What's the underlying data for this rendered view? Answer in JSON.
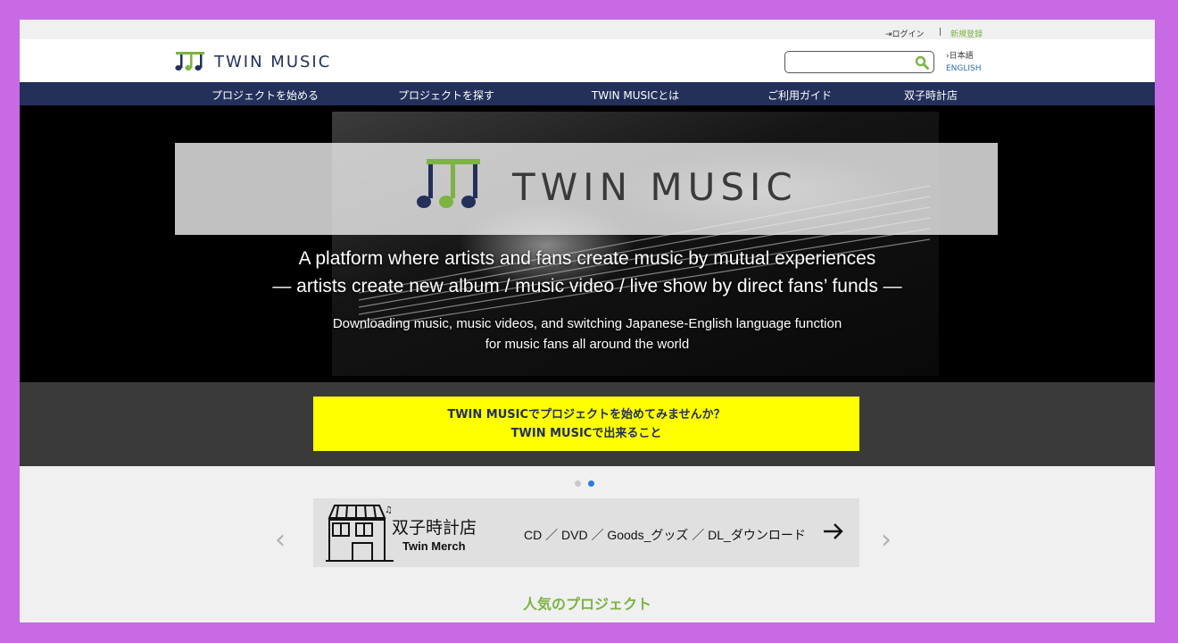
{
  "util": {
    "login": "ログイン",
    "separator": "|",
    "signup": "新規登録"
  },
  "header": {
    "brand": "TWIN MUSIC",
    "search_placeholder": "",
    "lang_ja": "›日本語",
    "lang_en": "ENGLISH"
  },
  "nav": {
    "items": [
      {
        "label": "プロジェクトを始める"
      },
      {
        "label": "プロジェクトを探す"
      },
      {
        "label": "TWIN MUSICとは"
      },
      {
        "label": "ご利用ガイド"
      },
      {
        "label": "双子時計店"
      }
    ]
  },
  "hero": {
    "brand": "TWIN MUSIC",
    "line1": "A platform where artists and fans create music by mutual experiences",
    "line2": "— artists create new album / music video / live show by direct fans’ funds —",
    "line3": "Downloading music, music videos, and switching Japanese-English language function",
    "line4": "for music fans all around the world"
  },
  "cta": {
    "line1": "TWIN MUSICでプロジェクトを始めてみませんか？",
    "line2": "TWIN MUSICで出来ること"
  },
  "carousel": {
    "slide_count": 2,
    "active_index": 1
  },
  "merch": {
    "shop_name": "双子時計店",
    "shop_sub": "Twin Merch",
    "categories": "CD ／ DVD ／ Goods_グッズ ／ DL_ダウンロード"
  },
  "sections": {
    "popular_title": "人気のプロジェクト"
  },
  "colors": {
    "navy": "#23305a",
    "green": "#7cb342",
    "cta_yellow": "#ffff00",
    "frame": "#c76ae4"
  }
}
